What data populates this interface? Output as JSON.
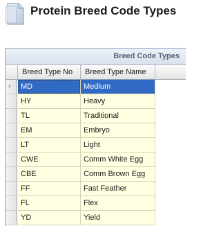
{
  "page": {
    "title": "Protein Breed Code Types",
    "icon": "document-icon"
  },
  "grid": {
    "caption": "Breed Code Types",
    "columns": [
      "Breed Type No",
      "Breed Type Name"
    ],
    "selected_index": 0,
    "rows": [
      {
        "no": "MD",
        "name": "Medium"
      },
      {
        "no": "HY",
        "name": "Heavy"
      },
      {
        "no": "TL",
        "name": "Traditional"
      },
      {
        "no": "EM",
        "name": "Embryo"
      },
      {
        "no": "LT",
        "name": "Light"
      },
      {
        "no": "CWE",
        "name": "Comm White Egg"
      },
      {
        "no": "CBE",
        "name": "Comm Brown Egg"
      },
      {
        "no": "FF",
        "name": "Fast Feather"
      },
      {
        "no": "FL",
        "name": "Flex"
      },
      {
        "no": "YD",
        "name": "Yield"
      }
    ]
  },
  "colors": {
    "selection": "#316ac5",
    "row_background": "#ffffe1"
  }
}
